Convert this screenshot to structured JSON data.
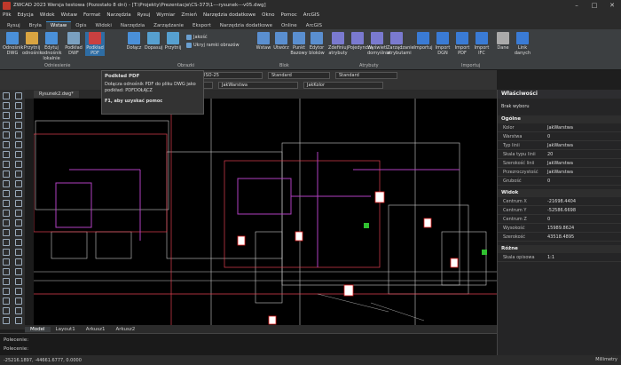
{
  "titlebar": {
    "text": "ZWCAD 2023 Wersja testowa (Pozostało 8 dni) - [T:\\Projekty\\Prezentacje\\CS-373\\1---rysunek---v05.dwg]"
  },
  "menu": [
    "Plik",
    "Edycja",
    "Widok",
    "Wstaw",
    "Format",
    "Narzędzia",
    "Rysuj",
    "Wymiar",
    "Zmień",
    "Narzędzia dodatkowe",
    "Okno",
    "Pomoc",
    "ArcGIS"
  ],
  "ribbon_tabs": [
    "Rysuj",
    "Bryła",
    "Wstaw",
    "Opis",
    "Widoki",
    "Narzędzia",
    "Zarządzanie",
    "Eksport",
    "Narzędzia dodatkowe",
    "Online",
    "ArcGIS"
  ],
  "ribbon_active": "Wstaw",
  "ribbon": {
    "buttons": [
      "Odnośnik DWG",
      "Przytnij odnośnik",
      "Edytuj odnośnik lokalnie",
      "Podkład DWF",
      "Podkład PDF",
      "Dołącz",
      "Dopasuj",
      "Przytnij",
      "Wstaw",
      "Utwórz",
      "Punkt Bazowy",
      "Edytor bloków",
      "Zdefiniuj atrybuty",
      "Pojedyncza",
      "Wyświetl domyślnie",
      "Zarządzanie atrybutami",
      "Importuj",
      "Import DGN",
      "Import PDF",
      "Import IFC",
      "Dane",
      "Link danych"
    ],
    "small": [
      "Jakość",
      "Ukryj ramki obrazów"
    ],
    "groups": [
      "Odniesienie",
      "Obrazki",
      "Blok",
      "Atrybuty",
      "Importuj"
    ]
  },
  "properties_bar": [
    "Standard",
    "ISO-25",
    "Standard",
    "Standard"
  ],
  "layer_bar": [
    "JakWarstwa",
    "JakWarstwa",
    "JakKolor"
  ],
  "tooltip": {
    "title": "Podkład PDF",
    "desc": "Dołącza odnośnik PDF do pliku DWG jako podkład: PDFDOŁĄCZ",
    "help": "F1, aby uzyskać pomoc"
  },
  "doc_tab": "Rysunek2.dwg*",
  "layout_tabs": [
    "Model",
    "Layout1",
    "Arkusz1",
    "Arkusz2"
  ],
  "command": {
    "line1": "Polecenie:",
    "line2": "Polecenie:"
  },
  "status": {
    "coords": "-25216.1897, -44661.6777, 0.0000",
    "scale": "Millimetry"
  },
  "properties_panel": {
    "title": "Właściwości",
    "selection": "Brak wyboru",
    "general_title": "Ogólne",
    "general": [
      {
        "k": "Kolor",
        "v": "JakWarstwa"
      },
      {
        "k": "Warstwa",
        "v": "0"
      },
      {
        "k": "Typ linii",
        "v": "JakWarstwa"
      },
      {
        "k": "Skala typu linii",
        "v": "20"
      },
      {
        "k": "Szerokość linii",
        "v": "JakWarstwa"
      },
      {
        "k": "Przezroczystość",
        "v": "JakWarstwa"
      },
      {
        "k": "Grubość",
        "v": "0"
      }
    ],
    "view_title": "Widok",
    "view": [
      {
        "k": "Centrum X",
        "v": "-21698.4404"
      },
      {
        "k": "Centrum Y",
        "v": "-52586.6698"
      },
      {
        "k": "Centrum Z",
        "v": "0"
      },
      {
        "k": "Wysokość",
        "v": "15989.8624"
      },
      {
        "k": "Szerokość",
        "v": "43518.4895"
      }
    ],
    "misc_title": "Różne",
    "misc": [
      {
        "k": "Skala opisowa",
        "v": "1:1"
      }
    ]
  }
}
